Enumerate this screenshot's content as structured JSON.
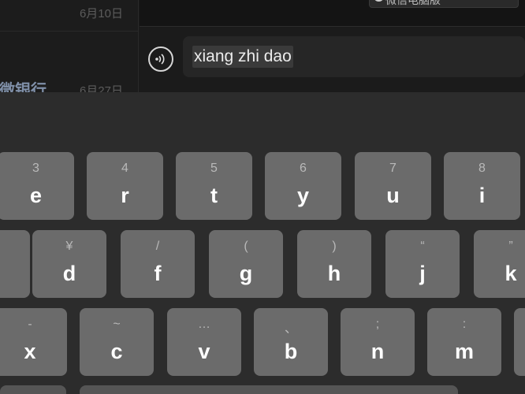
{
  "chat_list": {
    "items": [
      {
        "name": "",
        "date": "6月10日"
      },
      {
        "name": "微银行",
        "date": "6月27日"
      }
    ]
  },
  "top_bar": {
    "tooltip_text": "微信电脑版"
  },
  "compose": {
    "voice_icon": "voice-icon",
    "input_value": "xiang zhi dao"
  },
  "keyboard": {
    "rows": [
      [
        {
          "secondary": "3",
          "primary": "e"
        },
        {
          "secondary": "4",
          "primary": "r"
        },
        {
          "secondary": "5",
          "primary": "t"
        },
        {
          "secondary": "6",
          "primary": "y"
        },
        {
          "secondary": "7",
          "primary": "u"
        },
        {
          "secondary": "8",
          "primary": "i"
        }
      ],
      [
        {
          "secondary": "",
          "primary": ""
        },
        {
          "secondary": "¥",
          "primary": "d"
        },
        {
          "secondary": "/",
          "primary": "f"
        },
        {
          "secondary": "(",
          "primary": "g"
        },
        {
          "secondary": ")",
          "primary": "h"
        },
        {
          "secondary": "“",
          "primary": "j"
        },
        {
          "secondary": "”",
          "primary": "k"
        }
      ],
      [
        {
          "secondary": "-",
          "primary": "x"
        },
        {
          "secondary": "~",
          "primary": "c"
        },
        {
          "secondary": "…",
          "primary": "v"
        },
        {
          "secondary": "、",
          "primary": "b"
        },
        {
          "secondary": ";",
          "primary": "n"
        },
        {
          "secondary": ":",
          "primary": "m"
        },
        {
          "secondary": "",
          "primary": ""
        }
      ]
    ]
  }
}
